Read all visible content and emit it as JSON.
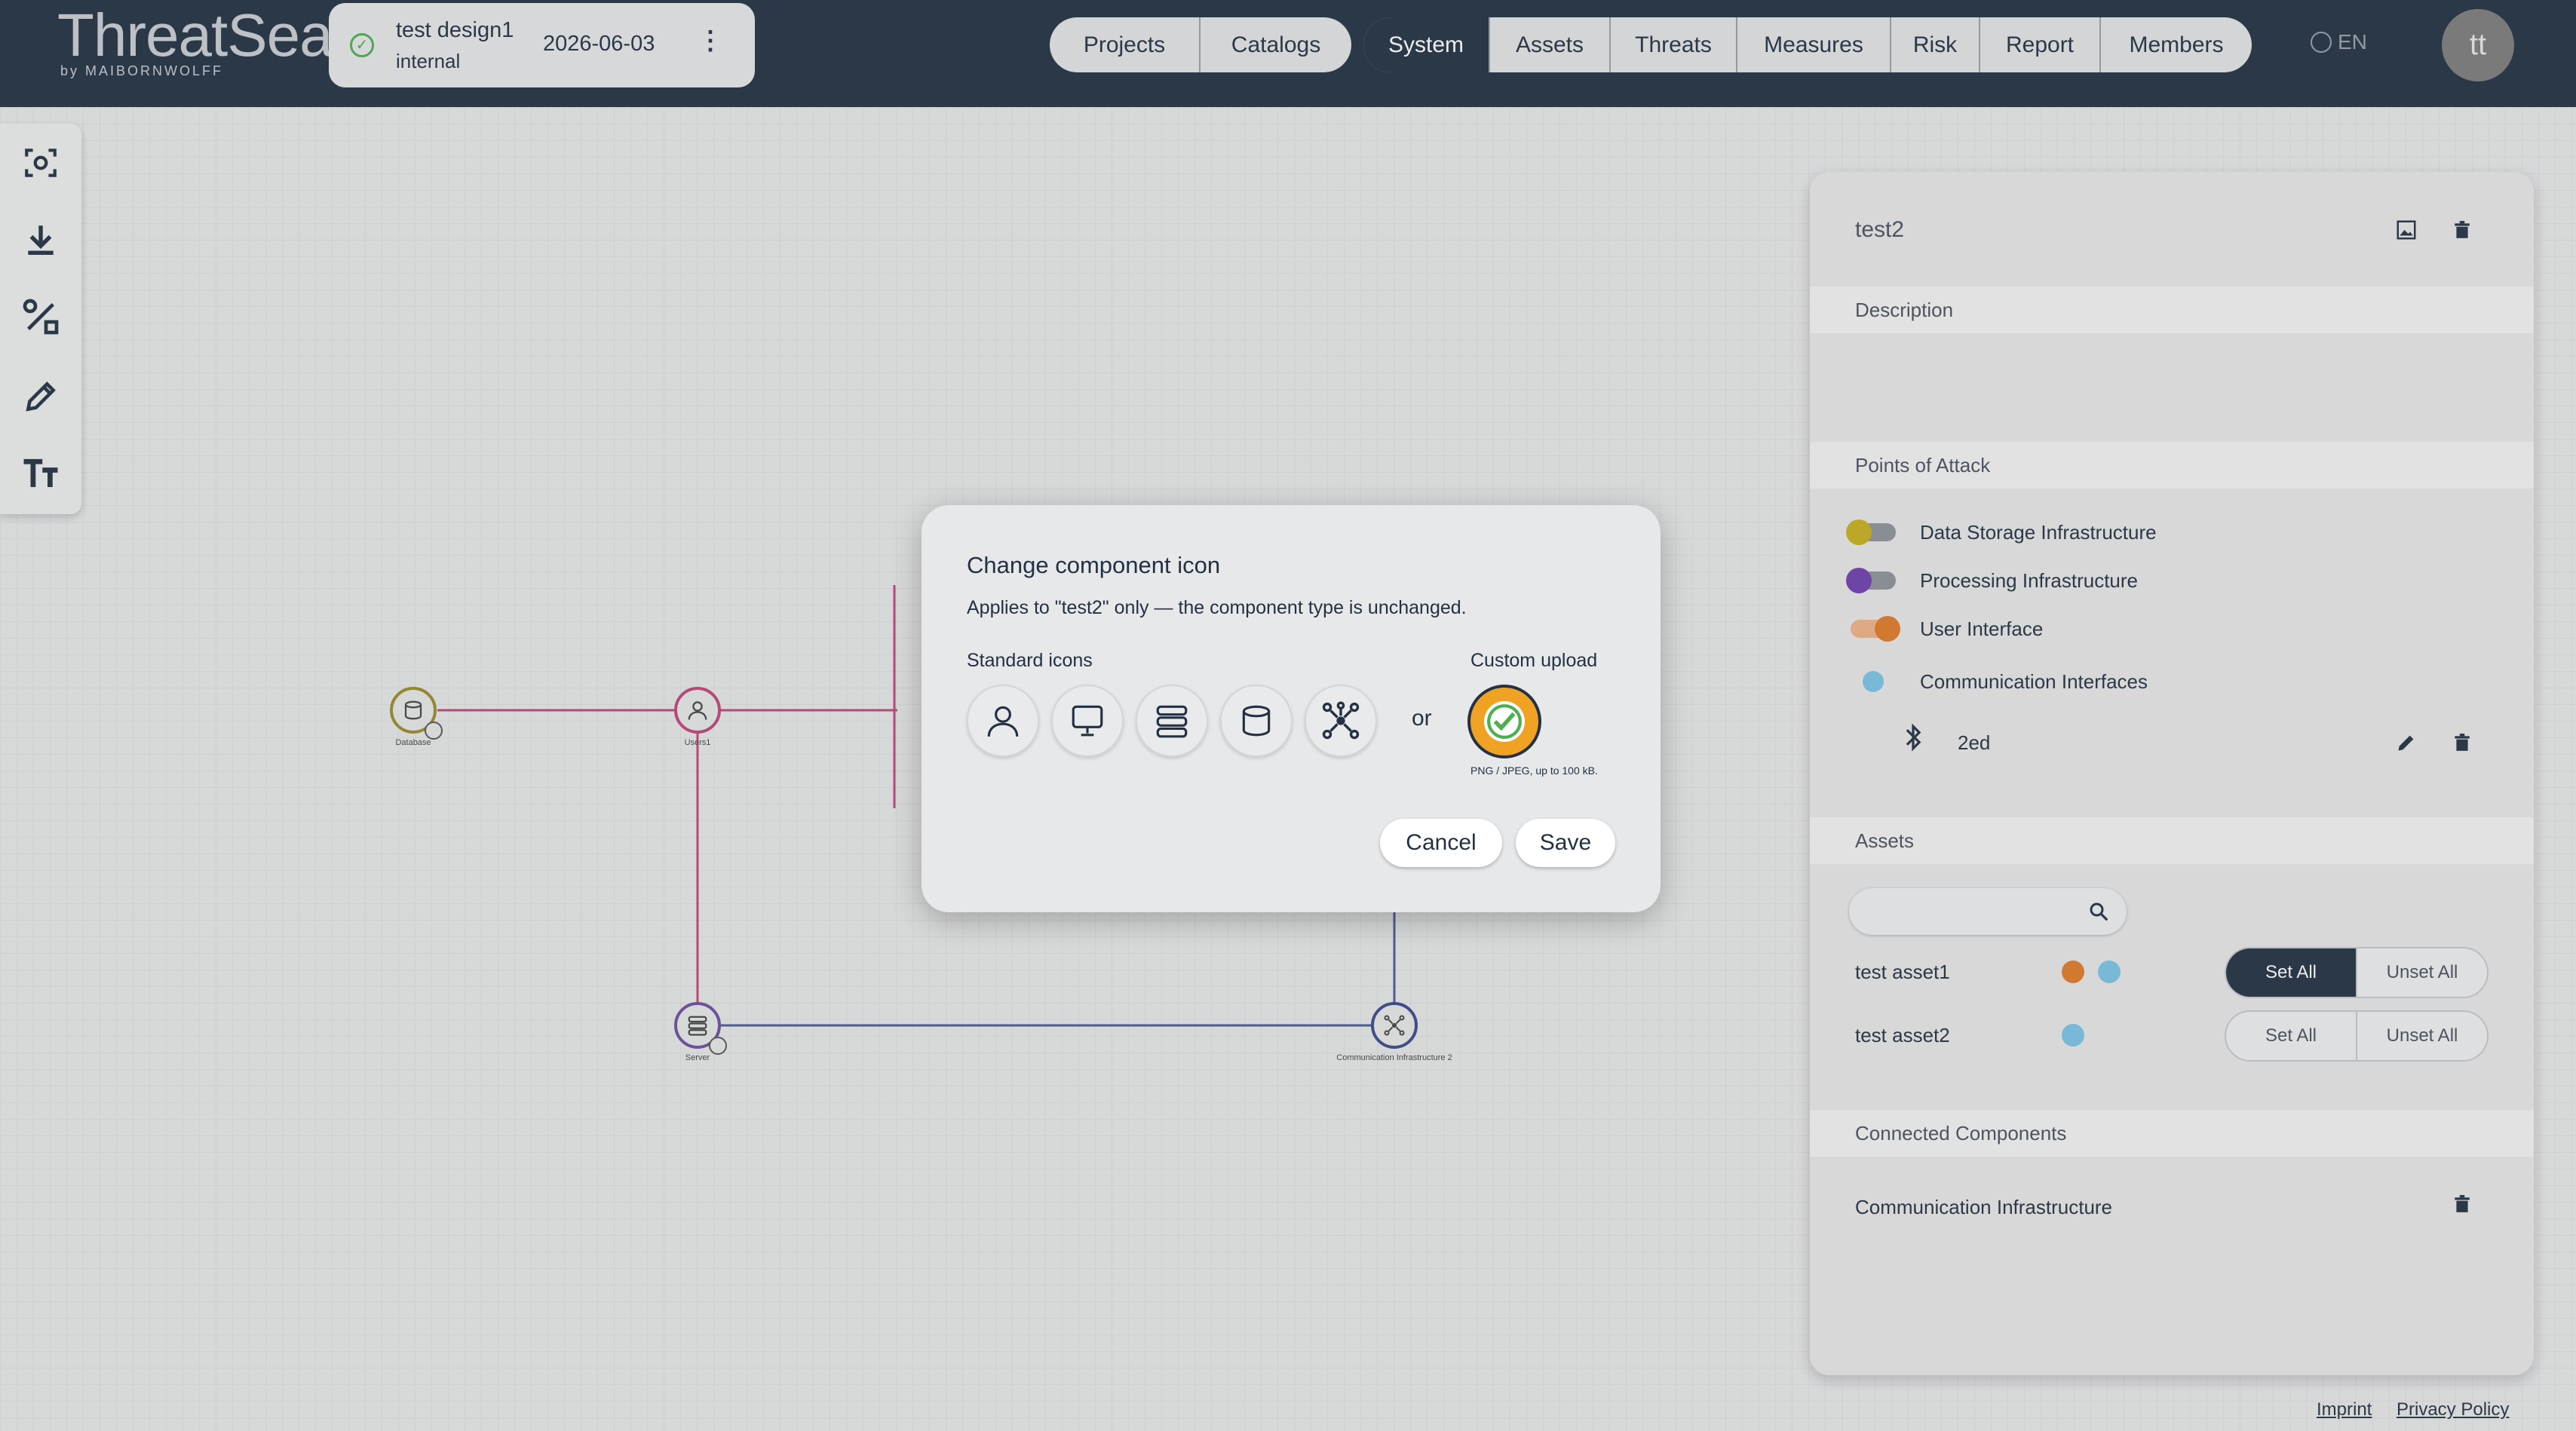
{
  "header": {
    "logo_text": "ThreatSea",
    "logo_sub": "by MAIBORNWOLFF",
    "project": {
      "name": "test design1",
      "type": "internal",
      "date": "2026-06-03",
      "menu_glyph": "⋮",
      "status_icon": "check-circle-icon"
    },
    "nav_primary": [
      "Projects",
      "Catalogs"
    ],
    "nav_secondary": [
      "System",
      "Assets",
      "Threats",
      "Measures",
      "Risk",
      "Report",
      "Members"
    ],
    "active_tab": "System",
    "language": "EN",
    "avatar_initials": "tt"
  },
  "toolbar": {
    "tools": [
      "focus-icon",
      "download-icon",
      "connect-icon",
      "pencil-icon",
      "text-size-icon"
    ]
  },
  "canvas": {
    "nodes": [
      {
        "label": "Database",
        "icon": "database-icon",
        "color": "#9b8a2a"
      },
      {
        "label": "Users1",
        "icon": "user-icon",
        "color": "#c0457a"
      },
      {
        "label": "Server",
        "icon": "server-icon",
        "color": "#6a4fa0"
      },
      {
        "label": "Communication Infrastructure 2",
        "icon": "network-icon",
        "color": "#3a4a8a"
      }
    ],
    "line_colors": {
      "pink": "#c0457a",
      "blue": "#4a5a9a"
    }
  },
  "panel": {
    "title": "test2",
    "description_header": "Description",
    "poa_header": "Points of Attack",
    "points_of_attack": [
      {
        "label": "Data Storage Infrastructure",
        "color": "#c9b020",
        "enabled": false
      },
      {
        "label": "Processing Infrastructure",
        "color": "#6f3fb0",
        "enabled": false
      },
      {
        "label": "User Interface",
        "color": "#e07a2a",
        "enabled": true
      },
      {
        "label": "Communication Interfaces",
        "color": "#7bc4e6",
        "enabled": true
      }
    ],
    "interface_item": {
      "label": "2ed",
      "icon": "bluetooth-icon"
    },
    "assets_header": "Assets",
    "assets": [
      {
        "name": "test asset1",
        "dots": [
          "#e07a2a",
          "#7bc4e6"
        ],
        "set_label": "Set All",
        "unset_label": "Unset All",
        "set_active": true
      },
      {
        "name": "test asset2",
        "dots": [
          "#7bc4e6"
        ],
        "set_label": "Set All",
        "unset_label": "Unset All",
        "set_active": false
      }
    ],
    "connected_header": "Connected Components",
    "connected": [
      "Communication Infrastructure"
    ]
  },
  "footer": {
    "imprint": "Imprint",
    "privacy": "Privacy Policy"
  },
  "modal": {
    "title": "Change component icon",
    "subtitle": "Applies to \"test2\" only — the component type is unchanged.",
    "standard_label": "Standard icons",
    "standard_icons": [
      "user-icon",
      "monitor-icon",
      "server-icon",
      "database-icon",
      "network-icon"
    ],
    "or_text": "or",
    "custom_label": "Custom upload",
    "custom_note": "PNG / JPEG, up to 100 kB.",
    "custom_colors": {
      "fill": "#f0a224",
      "check": "#4caf50"
    },
    "cancel": "Cancel",
    "save": "Save"
  }
}
